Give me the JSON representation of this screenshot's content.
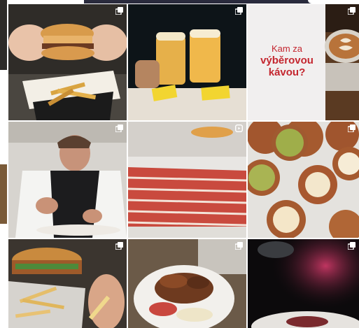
{
  "app": {
    "view": "profile-post-grid"
  },
  "colors": {
    "promo_text": "#c4262f",
    "promo_bg": "#f1efef",
    "badge": "#ffffff",
    "top_bar": "#2a2b3d"
  },
  "grid": {
    "posts": [
      {
        "id": "burger-fries",
        "badge": "multiple-photos-icon"
      },
      {
        "id": "beer-glasses",
        "badge": "multiple-photos-icon"
      },
      {
        "id": "promo-coffee",
        "badge": "multiple-photos-icon",
        "promo": {
          "line1": "Kam za",
          "line2": "výběrovou",
          "line3": "kávou?"
        }
      },
      {
        "id": "chef-plating",
        "badge": "multiple-photos-icon"
      },
      {
        "id": "beef-carpaccio",
        "badge": "reel-icon"
      },
      {
        "id": "cream-donuts",
        "badge": "multiple-photos-icon"
      },
      {
        "id": "chicken-burger",
        "badge": "multiple-photos-icon"
      },
      {
        "id": "pork-platter",
        "badge": "multiple-photos-icon"
      },
      {
        "id": "dark-dish",
        "badge": "multiple-photos-icon"
      }
    ]
  }
}
